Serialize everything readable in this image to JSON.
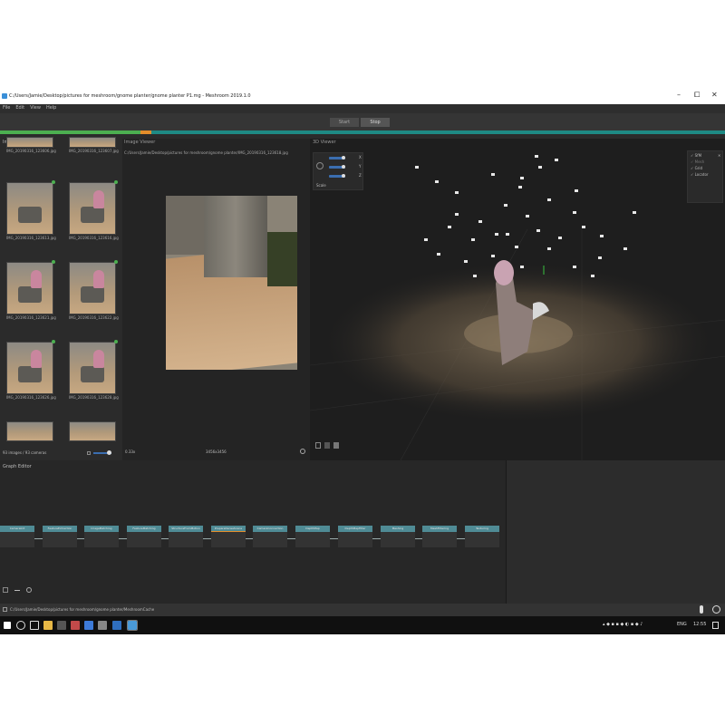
{
  "window": {
    "title": "C:/Users/Jamie/Desktop/pictures for meshroom/gnome planter/gnome planter P1.mg - Meshroom 2019.1.0",
    "controls": [
      "–",
      "⧠",
      "✕"
    ]
  },
  "menu": [
    "File",
    "Edit",
    "View",
    "Help"
  ],
  "toolbar": {
    "start_label": "Start",
    "stop_label": "Stop"
  },
  "images_panel": {
    "title": "Images",
    "thumbnails": [
      "IMG_20190316_123606.jpg",
      "IMG_20190316_123607.jpg",
      "IMG_20190316_123613.jpg",
      "IMG_20190316_123616.jpg",
      "IMG_20190316_123621.jpg",
      "IMG_20190316_123622.jpg",
      "IMG_20190316_123626.jpg",
      "IMG_20190316_123628.jpg"
    ],
    "footer": "93 images / 93 cameras"
  },
  "image_viewer": {
    "title": "Image Viewer",
    "path": "C:/Users/Jamie/Desktop/pictures for meshroom/gnome planter/IMG_20190316_123618.jpg",
    "zoom": "0.33x",
    "resolution": "3456x3456"
  },
  "viewer3d": {
    "title": "3D Viewer",
    "axis_labels": [
      "X",
      "Y",
      "Z"
    ],
    "scale_label": "Scale",
    "layers": [
      "SfM",
      "Mesh",
      "Grid",
      "Locator"
    ]
  },
  "graph_editor": {
    "title": "Graph Editor",
    "nodes": [
      "CameraInit",
      "FeatureExtraction",
      "ImageMatching",
      "FeatureMatching",
      "StructureFromMotion",
      "PrepareDenseScene",
      "CameraConnection",
      "DepthMap",
      "DepthMapFilter",
      "Meshing",
      "MeshFiltering",
      "Texturing"
    ]
  },
  "statusbar": {
    "path": "C:/Users/Jamie/Desktop/pictures for meshroom/gnome planter/MeshroomCache"
  },
  "taskbar": {
    "language": "ENG",
    "time": "12:55"
  },
  "colors": {
    "accent": "#1e8a84",
    "node_header": "#4f8b95",
    "progress_done": "#4caf50",
    "progress_current": "#e38d2b"
  }
}
